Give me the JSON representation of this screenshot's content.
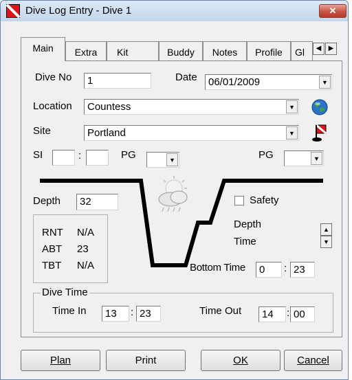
{
  "window": {
    "title": "Dive Log Entry - Dive 1",
    "close_label": "✕"
  },
  "tabs": [
    {
      "label": "Main"
    },
    {
      "label": "Extra"
    },
    {
      "label": "Kit"
    },
    {
      "label": "Buddy"
    },
    {
      "label": "Notes"
    },
    {
      "label": "Profile"
    },
    {
      "label": "Gl"
    }
  ],
  "tab_scroll": {
    "left": "◀",
    "right": "▶"
  },
  "main": {
    "dive_no_label": "Dive No",
    "dive_no_value": "1",
    "date_label": "Date",
    "date_value": "06/01/2009",
    "location_label": "Location",
    "location_value": "Countess",
    "site_label": "Site",
    "site_value": "Portland",
    "si_label": "SI",
    "si_hours": "",
    "si_sep": ":",
    "si_minutes": "",
    "pg_label_1": "PG",
    "pg_value_1": "",
    "pg_label_2": "PG",
    "pg_value_2": "",
    "depth_label": "Depth",
    "depth_value": "32",
    "safety_label": "Safety",
    "safety_checked": false,
    "depth_time_label_1": "Depth",
    "depth_time_label_2": "Time",
    "stats": [
      {
        "label": "RNT",
        "value": "N/A"
      },
      {
        "label": "ABT",
        "value": "23"
      },
      {
        "label": "TBT",
        "value": "N/A"
      }
    ],
    "bottom_time_label": "Bottom Time",
    "bottom_time_hours": "0",
    "bottom_time_sep": ":",
    "bottom_time_minutes": "23",
    "dive_time_group_label": "Dive Time",
    "time_in_label": "Time In",
    "time_in_hours": "13",
    "time_in_sep": ":",
    "time_in_minutes": "23",
    "time_out_label": "Time Out",
    "time_out_hours": "14",
    "time_out_sep": ":",
    "time_out_minutes": "00"
  },
  "buttons": {
    "plan": "Plan",
    "print": "Print",
    "ok": "OK",
    "cancel": "Cancel"
  },
  "icons": {
    "dropdown": "▼",
    "spin_up": "▲",
    "spin_down": "▼"
  },
  "colors": {
    "profile_line": "#000000",
    "title_icon": "#d8161b",
    "close": "#c65447"
  }
}
